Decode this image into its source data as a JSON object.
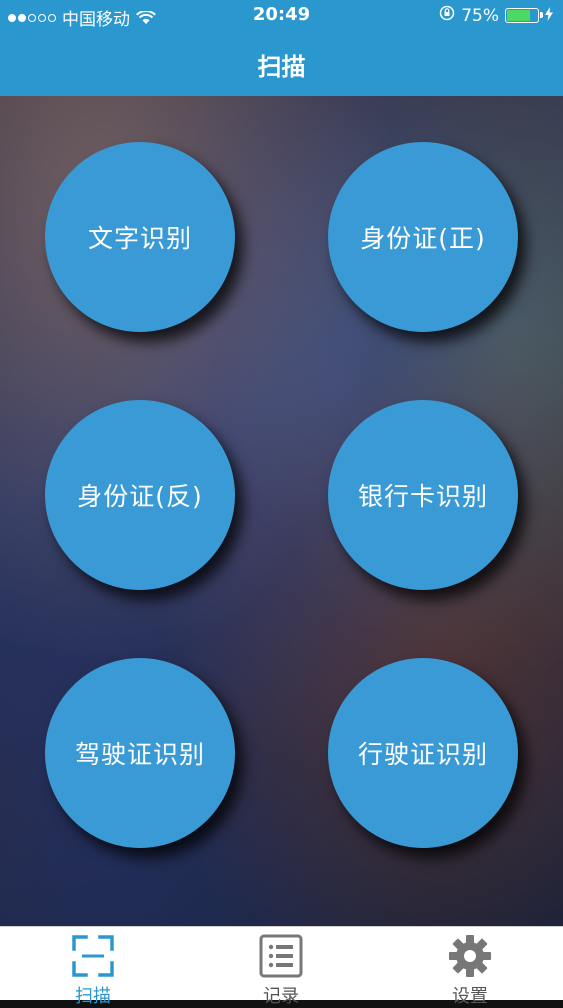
{
  "status_bar": {
    "carrier": "中国移动",
    "time": "20:49",
    "battery": "75%",
    "battery_level": 0.75
  },
  "header": {
    "title": "扫描"
  },
  "buttons": [
    {
      "label": "文字识别"
    },
    {
      "label": "身份证(正)"
    },
    {
      "label": "身份证(反)"
    },
    {
      "label": "银行卡识别"
    },
    {
      "label": "驾驶证识别"
    },
    {
      "label": "行驶证识别"
    }
  ],
  "tabbar": {
    "active_color": "#2a98cf",
    "tabs": [
      {
        "label": "扫描",
        "icon": "scan-icon"
      },
      {
        "label": "记录",
        "icon": "list-icon"
      },
      {
        "label": "设置",
        "icon": "gear-icon"
      }
    ]
  }
}
